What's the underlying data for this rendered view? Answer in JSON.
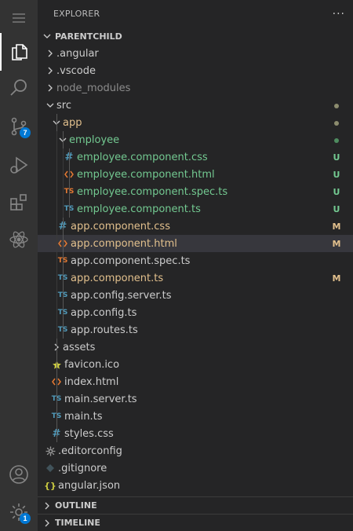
{
  "explorer": {
    "title": "EXPLORER",
    "more": "···"
  },
  "workspace": {
    "name": "PARENTCHILD"
  },
  "activity": {
    "source_control_badge": "7",
    "manage_badge": "1"
  },
  "tree": [
    {
      "label": ".angular",
      "type": "folder",
      "depth": 1,
      "expanded": false,
      "color": "default"
    },
    {
      "label": ".vscode",
      "type": "folder",
      "depth": 1,
      "expanded": false,
      "color": "default"
    },
    {
      "label": "node_modules",
      "type": "folder",
      "depth": 1,
      "expanded": false,
      "color": "dim"
    },
    {
      "label": "src",
      "type": "folder",
      "depth": 1,
      "expanded": true,
      "color": "default",
      "dot": "#8c8c6e"
    },
    {
      "label": "app",
      "type": "folder",
      "depth": 2,
      "expanded": true,
      "color": "mod",
      "dot": "#8c8c6e"
    },
    {
      "label": "employee",
      "type": "folder",
      "depth": 3,
      "expanded": true,
      "color": "new",
      "dot": "#4e8c5f"
    },
    {
      "label": "employee.component.css",
      "type": "css",
      "depth": 4,
      "color": "new",
      "status": "U"
    },
    {
      "label": "employee.component.html",
      "type": "html",
      "depth": 4,
      "color": "new",
      "status": "U"
    },
    {
      "label": "employee.component.spec.ts",
      "type": "spec",
      "depth": 4,
      "color": "new",
      "status": "U"
    },
    {
      "label": "employee.component.ts",
      "type": "ts",
      "depth": 4,
      "color": "new",
      "status": "U"
    },
    {
      "label": "app.component.css",
      "type": "css",
      "depth": 3,
      "color": "mod",
      "status": "M"
    },
    {
      "label": "app.component.html",
      "type": "html",
      "depth": 3,
      "color": "mod",
      "status": "M",
      "selected": true
    },
    {
      "label": "app.component.spec.ts",
      "type": "spec",
      "depth": 3,
      "color": "default"
    },
    {
      "label": "app.component.ts",
      "type": "ts",
      "depth": 3,
      "color": "mod",
      "status": "M"
    },
    {
      "label": "app.config.server.ts",
      "type": "ts",
      "depth": 3,
      "color": "default"
    },
    {
      "label": "app.config.ts",
      "type": "ts",
      "depth": 3,
      "color": "default"
    },
    {
      "label": "app.routes.ts",
      "type": "ts",
      "depth": 3,
      "color": "default"
    },
    {
      "label": "assets",
      "type": "folder",
      "depth": 2,
      "expanded": false,
      "color": "default"
    },
    {
      "label": "favicon.ico",
      "type": "star",
      "depth": 2,
      "color": "default"
    },
    {
      "label": "index.html",
      "type": "html",
      "depth": 2,
      "color": "default"
    },
    {
      "label": "main.server.ts",
      "type": "ts",
      "depth": 2,
      "color": "default"
    },
    {
      "label": "main.ts",
      "type": "ts",
      "depth": 2,
      "color": "default"
    },
    {
      "label": "styles.css",
      "type": "css",
      "depth": 2,
      "color": "default"
    },
    {
      "label": ".editorconfig",
      "type": "gear",
      "depth": 1,
      "color": "default"
    },
    {
      "label": ".gitignore",
      "type": "git",
      "depth": 1,
      "color": "default"
    },
    {
      "label": "angular.json",
      "type": "json",
      "depth": 1,
      "color": "default"
    }
  ],
  "sections": {
    "outline": "OUTLINE",
    "timeline": "TIMELINE"
  },
  "colors": {
    "modified": "#e2c08d",
    "untracked": "#73c991",
    "accent": "#0078d4"
  }
}
